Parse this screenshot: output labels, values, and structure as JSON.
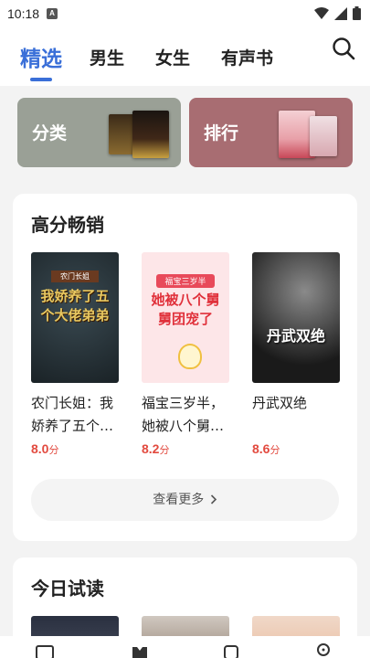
{
  "status": {
    "time": "10:18",
    "notification_letter": "A"
  },
  "nav": {
    "tabs": [
      {
        "label": "精选",
        "active": true
      },
      {
        "label": "男生",
        "active": false
      },
      {
        "label": "女生",
        "active": false
      },
      {
        "label": "有声书",
        "active": false
      }
    ],
    "search_icon": "search-icon"
  },
  "tiles": [
    {
      "label": "分类",
      "color": "#9aa096"
    },
    {
      "label": "排行",
      "color": "#a86d72"
    }
  ],
  "bestsellers": {
    "title": "高分畅销",
    "books": [
      {
        "title": "农门长姐：我娇养了五个大佬弟弟",
        "display_title": "农门长姐：我娇养了五个…",
        "score": "8.0",
        "unit": "分",
        "cover_text": "我娇养了五个大佬弟弟",
        "cover_sub": "农门长姐"
      },
      {
        "title": "福宝三岁半，她被八个舅舅团宠了",
        "display_title": "福宝三岁半，她被八个舅…",
        "score": "8.2",
        "unit": "分",
        "cover_text": "她被八个舅舅团宠了",
        "cover_sub": "福宝三岁半"
      },
      {
        "title": "丹武双绝",
        "display_title": "丹武双绝",
        "score": "8.6",
        "unit": "分",
        "cover_text": "丹武双绝"
      }
    ],
    "more_label": "查看更多"
  },
  "trial": {
    "title": "今日试读"
  },
  "colors": {
    "accent": "#3a6fd8",
    "score": "#e24a3f"
  }
}
